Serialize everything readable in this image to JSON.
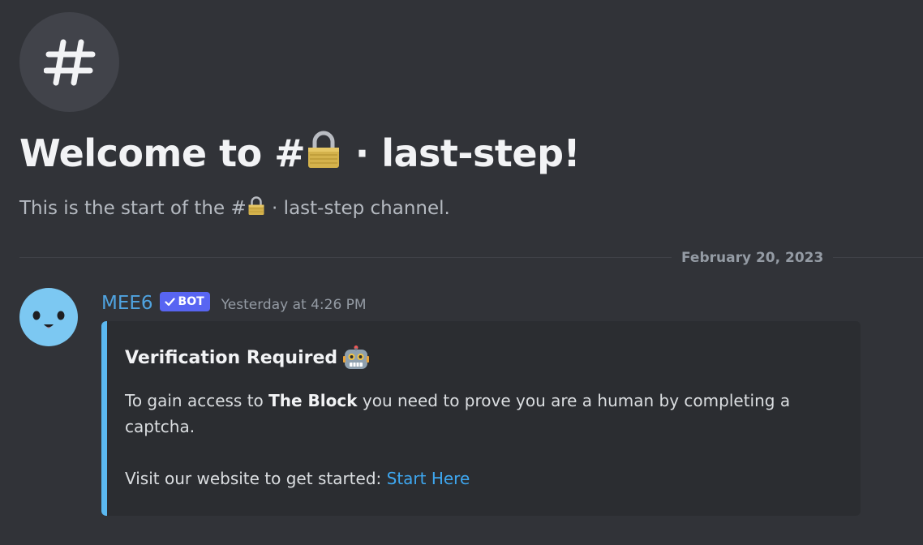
{
  "channel": {
    "icon": "hash-icon",
    "welcome_prefix": "Welcome to #",
    "welcome_suffix": " · last-step!",
    "start_prefix": "This is the start of the #",
    "start_suffix": " · last-step channel.",
    "emoji": "lock-icon"
  },
  "divider": {
    "date": "February 20, 2023"
  },
  "message": {
    "author": "MEE6",
    "author_color": "#4fa3e0",
    "badge": "BOT",
    "badge_color": "#5865f2",
    "timestamp": "Yesterday at 4:26 PM",
    "embed": {
      "accent_color": "#5bb8f0",
      "title": "Verification Required",
      "title_emoji": "robot-icon",
      "desc_prefix": "To gain access to ",
      "desc_bold": "The Block",
      "desc_suffix": " you need to prove you are a human by completing a captcha.",
      "visit_text": "Visit our website to get started: ",
      "link_text": "Start Here"
    }
  }
}
